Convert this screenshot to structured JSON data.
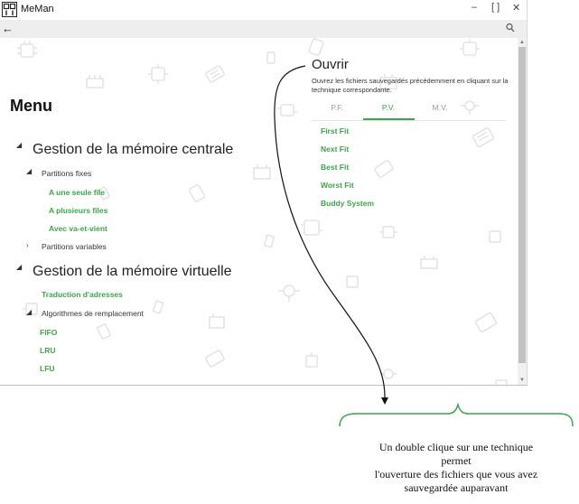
{
  "app": {
    "title": "MeMan"
  },
  "window_controls": {
    "minimize": "–",
    "maximize": "[ ]",
    "close": "✕"
  },
  "nav": {
    "back": "←"
  },
  "menu": {
    "title": "Menu",
    "sections": [
      {
        "title": "Gestion de la mémoire centrale",
        "groups": [
          {
            "label": "Partitions fixes",
            "items": [
              "A une seule file",
              "A plusieurs files",
              "Avec va-et-vient"
            ]
          },
          {
            "label": "Partitions variables",
            "items": []
          }
        ]
      },
      {
        "title": "Gestion de la mémoire virtuelle",
        "items": [
          "Traduction d'adresses"
        ],
        "groups": [
          {
            "label": "Algorithmes de remplacement",
            "items": [
              "FIFO",
              "LRU",
              "LFU"
            ]
          }
        ]
      }
    ]
  },
  "open_panel": {
    "title": "Ouvrir",
    "description": "Ouvrez les fichiers sauvegardés précédemment en cliquant sur la technique correspondante.",
    "tabs": [
      "P.F.",
      "P.V.",
      "M.V."
    ],
    "active_tab": 1,
    "techniques": [
      "First Fit",
      "Next Fit",
      "Best Fit",
      "Worst Fit",
      "Buddy System"
    ]
  },
  "annotation": {
    "lines": [
      "Un double clique sur une technique",
      "permet",
      "l'ouverture des fichiers que vous avez",
      "sauvegardée auparavant"
    ],
    "color": "#3aa64a"
  },
  "colors": {
    "accent": "#3aa64a",
    "navbar": "#eeeeee"
  }
}
